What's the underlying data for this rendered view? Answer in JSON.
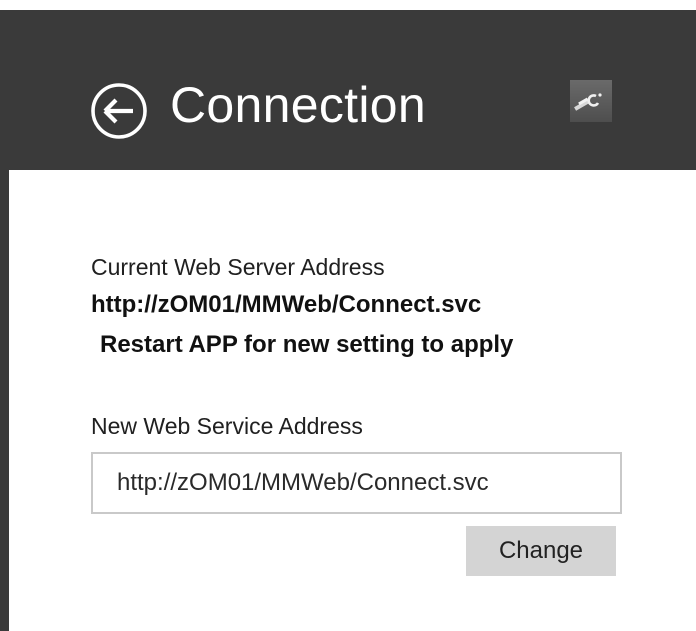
{
  "header": {
    "title": "Connection",
    "back_icon": "back-arrow-circle-icon",
    "tool_icon": "wrench-icon",
    "background_color": "#3a3a3a"
  },
  "current_server": {
    "label": "Current Web Server Address",
    "address": "http://zOM01/MMWeb/Connect.svc",
    "restart_note": "Restart APP for new setting to apply"
  },
  "new_service": {
    "label": "New Web Service Address",
    "input_value": "http://zOM01/MMWeb/Connect.svc",
    "change_label": "Change"
  }
}
